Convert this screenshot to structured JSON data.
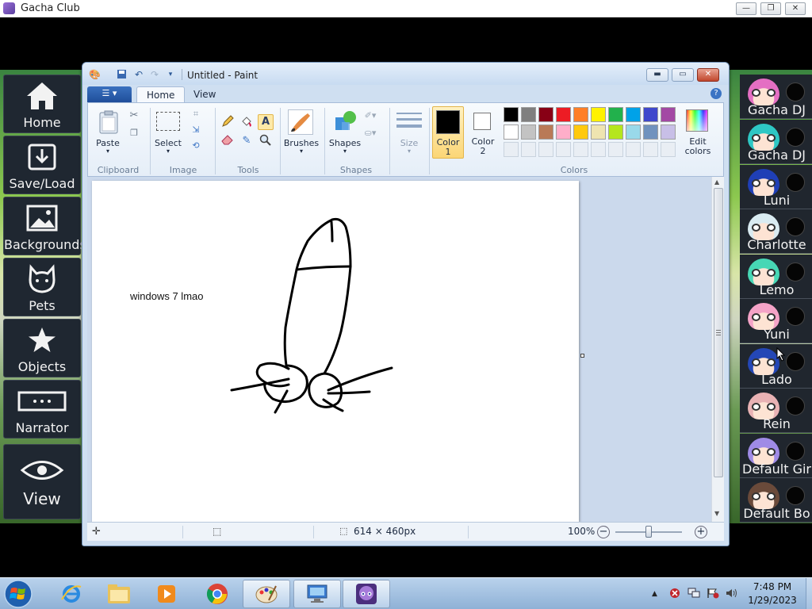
{
  "gacha": {
    "title": "Gacha Club",
    "controls": {
      "minimize": "—",
      "restore": "❐",
      "close": "✕"
    },
    "menu": [
      {
        "label": "Home"
      },
      {
        "label": "Save/Load"
      },
      {
        "label": "Backgrounds"
      },
      {
        "label": "Pets"
      },
      {
        "label": "Objects"
      },
      {
        "label": "Narrator"
      },
      {
        "label": "View"
      }
    ],
    "characters": [
      {
        "name": "Gacha DJ",
        "hair": "#e46fc3"
      },
      {
        "name": "Gacha DJ",
        "hair": "#2ec7c4"
      },
      {
        "name": "Luni",
        "hair": "#1f3fb6"
      },
      {
        "name": "Charlotte",
        "hair": "#d9ebf1"
      },
      {
        "name": "Lemo",
        "hair": "#47d7b5"
      },
      {
        "name": "Yuni",
        "hair": "#f4a3c7"
      },
      {
        "name": "Lado",
        "hair": "#2447b6"
      },
      {
        "name": "Rein",
        "hair": "#e9b2b4"
      },
      {
        "name": "Default Gir",
        "hair": "#9f8be6"
      },
      {
        "name": "Default Bo",
        "hair": "#6a4a3a"
      }
    ]
  },
  "paint": {
    "title": "Untitled - Paint",
    "tabs": {
      "file_icon": "☰ ▾",
      "home": "Home",
      "view": "View"
    },
    "help": "?",
    "controls": {
      "minimize": "▬",
      "maximize": "▭",
      "close": "✕"
    },
    "groups": {
      "clipboard": "Clipboard",
      "image": "Image",
      "tools": "Tools",
      "shapes": "Shapes",
      "colors": "Colors"
    },
    "buttons": {
      "paste": "Paste",
      "select": "Select",
      "brushes": "Brushes",
      "shapes": "Shapes",
      "size": "Size",
      "color1_a": "Color",
      "color1_b": "1",
      "color2_a": "Color",
      "color2_b": "2",
      "edit_a": "Edit",
      "edit_b": "colors"
    },
    "color1": "#000000",
    "color2": "#ffffff",
    "palette_row1": [
      "#000000",
      "#7f7f7f",
      "#880015",
      "#ed1c24",
      "#ff7f27",
      "#fff200",
      "#22b14c",
      "#00a2e8",
      "#3f48cc",
      "#a349a4"
    ],
    "palette_row2": [
      "#ffffff",
      "#c3c3c3",
      "#b97a57",
      "#ffaec9",
      "#ffc90e",
      "#efe4b0",
      "#b5e61d",
      "#99d9ea",
      "#7092be",
      "#c8bfe7"
    ],
    "canvas_text": "windows 7 lmao",
    "status": {
      "size": "614 × 460px",
      "zoom": "100%"
    }
  },
  "taskbar": {
    "time": "7:48 PM",
    "date": "1/29/2023"
  }
}
